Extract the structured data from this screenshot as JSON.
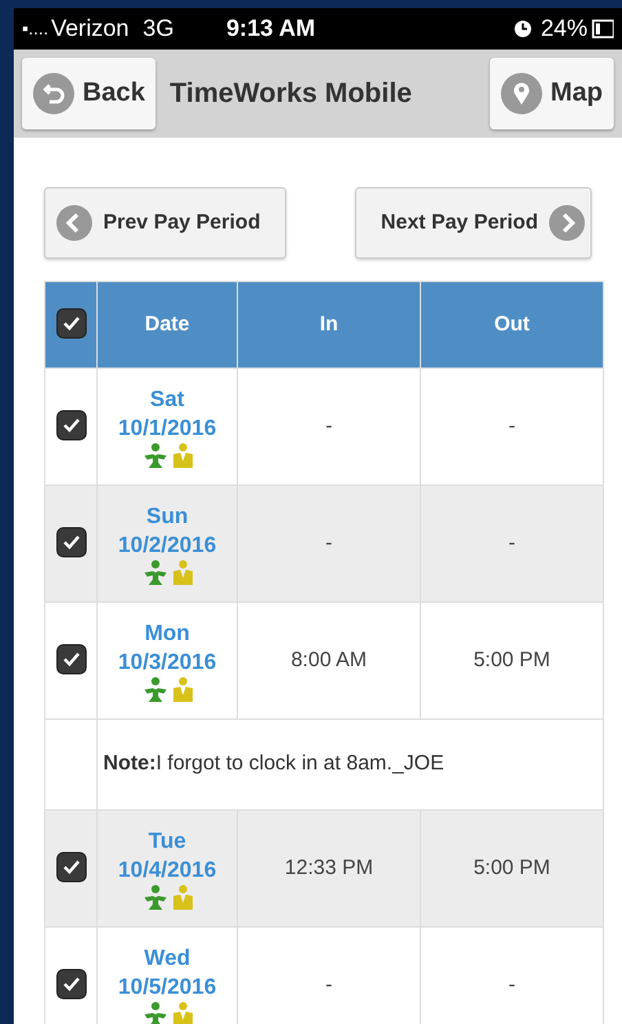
{
  "status_bar": {
    "signal": "▪....",
    "carrier": "Verizon",
    "network": "3G",
    "time": "9:13 AM",
    "battery": "24%"
  },
  "nav_bar": {
    "back": "Back",
    "title": "TimeWorks Mobile",
    "map": "Map"
  },
  "pager": {
    "prev": "Prev Pay Period",
    "next": "Next Pay Period"
  },
  "table": {
    "select_all": {
      "checked": true
    },
    "columns": [
      "Date",
      "In",
      "Out"
    ],
    "rows": [
      {
        "kind": "day",
        "checked": true,
        "day": "Sat",
        "date": "10/1/2016",
        "in": "-",
        "out": "-"
      },
      {
        "kind": "day",
        "checked": true,
        "day": "Sun",
        "date": "10/2/2016",
        "in": "-",
        "out": "-"
      },
      {
        "kind": "day",
        "checked": true,
        "day": "Mon",
        "date": "10/3/2016",
        "in": "8:00 AM",
        "out": "5:00 PM"
      },
      {
        "kind": "note",
        "label": "Note:",
        "text": "I forgot to clock in at 8am._JOE"
      },
      {
        "kind": "day",
        "checked": true,
        "day": "Tue",
        "date": "10/4/2016",
        "in": "12:33 PM",
        "out": "5:00 PM"
      },
      {
        "kind": "day",
        "checked": true,
        "day": "Wed",
        "date": "10/5/2016",
        "in": "-",
        "out": "-"
      }
    ]
  }
}
